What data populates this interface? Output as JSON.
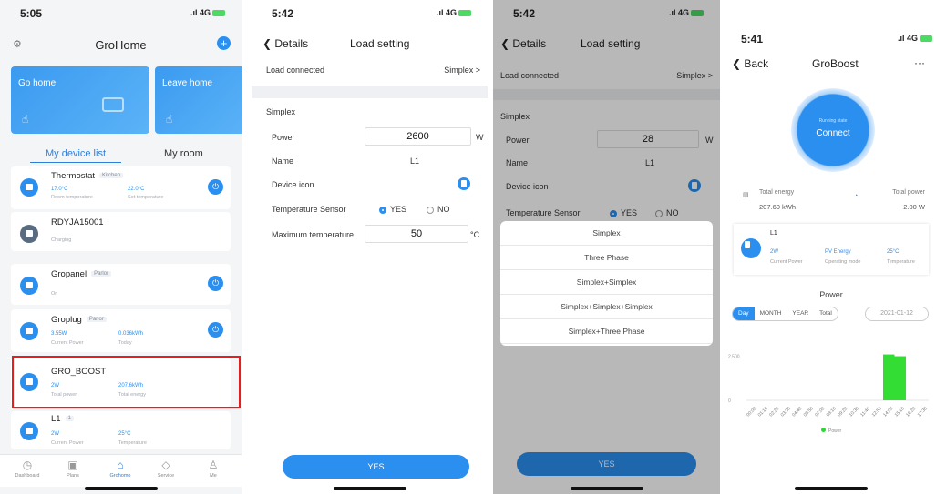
{
  "p1": {
    "time": "5:05",
    "net": "4G",
    "title": "GroHome",
    "scenes": [
      "Go home",
      "Leave home"
    ],
    "tabs": [
      "My device list",
      "My room"
    ],
    "devices": [
      {
        "name": "Thermostat",
        "tag": "Kitchen",
        "v1": "17.0°C",
        "l1": "Room temperature",
        "v2": "22.0°C",
        "l2": "Set temperature"
      },
      {
        "name": "RDYJA15001",
        "sub": "Charging"
      },
      {
        "name": "Gropanel",
        "tag": "Parlor",
        "sub": "On"
      },
      {
        "name": "Groplug",
        "tag": "Parlor",
        "v1": "3.55W",
        "l1": "Current Power",
        "v2": "0.036kWh",
        "l2": "Today"
      },
      {
        "name": "GRO_BOOST",
        "v1": "2W",
        "l1": "Total power",
        "v2": "207.6kWh",
        "l2": "Total energy"
      },
      {
        "name": "L1",
        "tag": "1",
        "v1": "2W",
        "l1": "Current Power",
        "v2": "25°C",
        "l2": "Temperature"
      }
    ],
    "nav": [
      "Dashboard",
      "Plans",
      "Grohomo",
      "Service",
      "Me"
    ]
  },
  "p2": {
    "time": "5:42",
    "net": "4G",
    "back": "Details",
    "title": "Load setting",
    "load_label": "Load connected",
    "load_value": "Simplex >",
    "section": "Simplex",
    "power_label": "Power",
    "power": "2600",
    "power_unit": "W",
    "name_label": "Name",
    "name": "L1",
    "icon_label": "Device icon",
    "sensor_label": "Temperature Sensor",
    "yes": "YES",
    "no": "NO",
    "max_label": "Maximum temperature",
    "max": "50",
    "max_unit": "°C",
    "button": "YES"
  },
  "p3": {
    "time": "5:42",
    "net": "4G",
    "back": "Details",
    "title": "Load setting",
    "load_label": "Load connected",
    "load_value": "Simplex >",
    "section": "Simplex",
    "power_label": "Power",
    "power": "28",
    "power_unit": "W",
    "name_label": "Name",
    "name": "L1",
    "icon_label": "Device icon",
    "sensor_label": "Temperature Sensor",
    "yes": "YES",
    "no": "NO",
    "options": [
      "Simplex",
      "Three Phase",
      "Simplex+Simplex",
      "Simplex+Simplex+Simplex",
      "Simplex+Three Phase"
    ],
    "button": "YES"
  },
  "p4": {
    "time": "5:41",
    "net": "4G",
    "back": "Back",
    "title": "GroBoost",
    "more": "···",
    "ring_status": "Running state",
    "ring_action": "Connect",
    "energy_label": "Total energy",
    "energy": "207.60 kWh",
    "power_label": "Total power",
    "power": "2.00 W",
    "card": {
      "name": "L1",
      "v1": "2W",
      "l1": "Current Power",
      "v2": "PV Energy",
      "l2": "Operating mode",
      "v3": "25°C",
      "l3": "Temperature"
    },
    "chart_title": "Power",
    "segments": [
      "Day",
      "MONTH",
      "YEAR",
      "Total"
    ],
    "date": "2021-01-12",
    "legend": "Power",
    "chart_data": {
      "type": "bar",
      "title": "Power",
      "ylabel": "",
      "y_ticks": [
        "0",
        "2,500"
      ],
      "categories": [
        "00:00",
        "01:10",
        "02:20",
        "03:30",
        "04:40",
        "05:50",
        "07:00",
        "08:10",
        "09:20",
        "10:30",
        "11:40",
        "12:50",
        "14:00",
        "15:10",
        "16:20",
        "17:30"
      ],
      "values": [
        0,
        0,
        0,
        0,
        0,
        0,
        0,
        0,
        0,
        0,
        0,
        0,
        2600,
        2500,
        0,
        0
      ]
    }
  }
}
